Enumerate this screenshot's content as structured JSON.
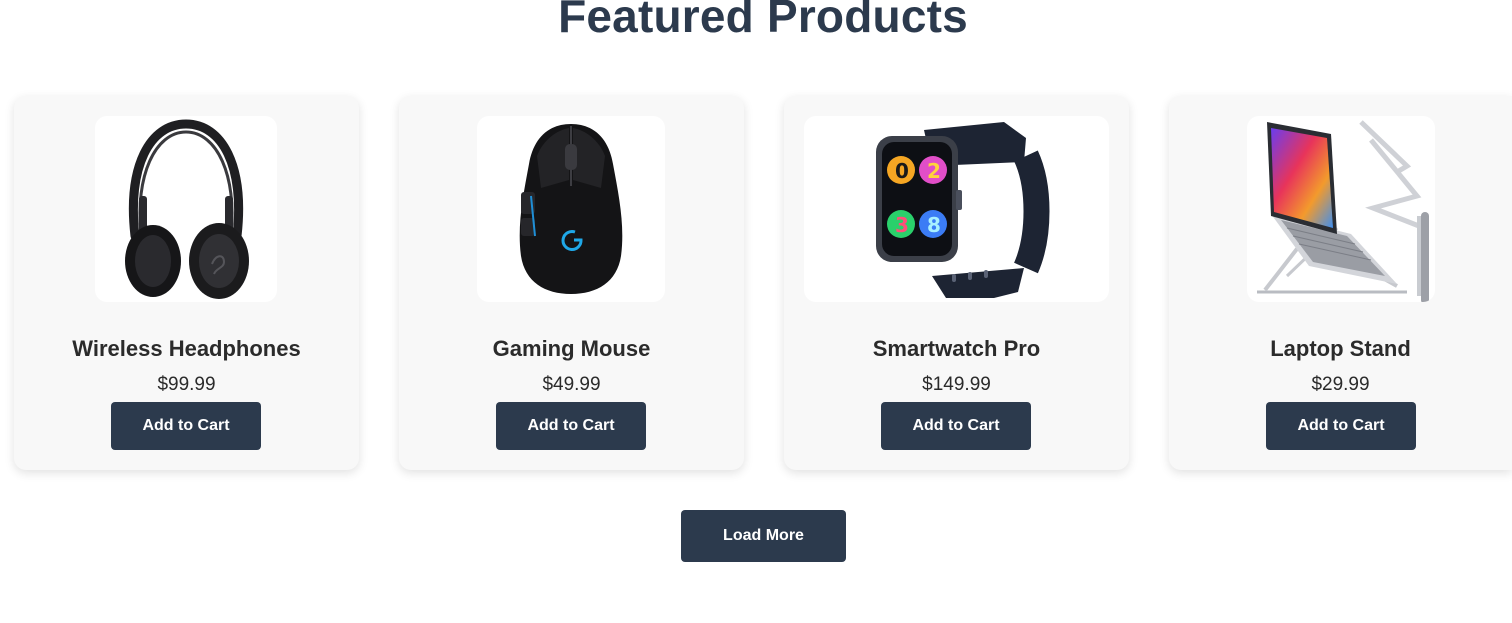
{
  "section": {
    "title": "Featured Products"
  },
  "products": [
    {
      "name": "Wireless Headphones",
      "price": "$99.99",
      "button_label": "Add to Cart",
      "image_icon": "headphones-image"
    },
    {
      "name": "Gaming Mouse",
      "price": "$49.99",
      "button_label": "Add to Cart",
      "image_icon": "gaming-mouse-image"
    },
    {
      "name": "Smartwatch Pro",
      "price": "$149.99",
      "button_label": "Add to Cart",
      "image_icon": "smartwatch-image"
    },
    {
      "name": "Laptop Stand",
      "price": "$29.99",
      "button_label": "Add to Cart",
      "image_icon": "laptop-stand-image"
    }
  ],
  "load_more": {
    "label": "Load More"
  },
  "colors": {
    "primary": "#2c3a4d",
    "card_bg": "#f8f8f8",
    "text": "#2b2b2b"
  }
}
